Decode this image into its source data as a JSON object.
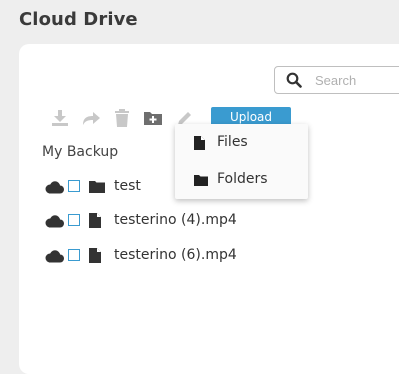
{
  "app": {
    "title": "Cloud Drive"
  },
  "search": {
    "placeholder": "Search",
    "value": ""
  },
  "toolbar": {
    "tools": [
      "download-icon",
      "share-icon",
      "trash-icon",
      "new-folder-icon",
      "edit-icon"
    ],
    "upload_label": "Upload",
    "upload_color": "#3a9bd0"
  },
  "upload_menu": {
    "items": [
      {
        "label": "Files",
        "icon": "file-icon"
      },
      {
        "label": "Folders",
        "icon": "folder-icon"
      }
    ]
  },
  "breadcrumb": {
    "current": "My Backup"
  },
  "files": [
    {
      "name": "test",
      "type": "folder",
      "checked": false
    },
    {
      "name": "testerino (4).mp4",
      "type": "file",
      "checked": false
    },
    {
      "name": "testerino (6).mp4",
      "type": "file",
      "checked": false
    }
  ],
  "colors": {
    "accent": "#3a9bd0",
    "background": "#eeeeee",
    "panel": "#ffffff"
  }
}
